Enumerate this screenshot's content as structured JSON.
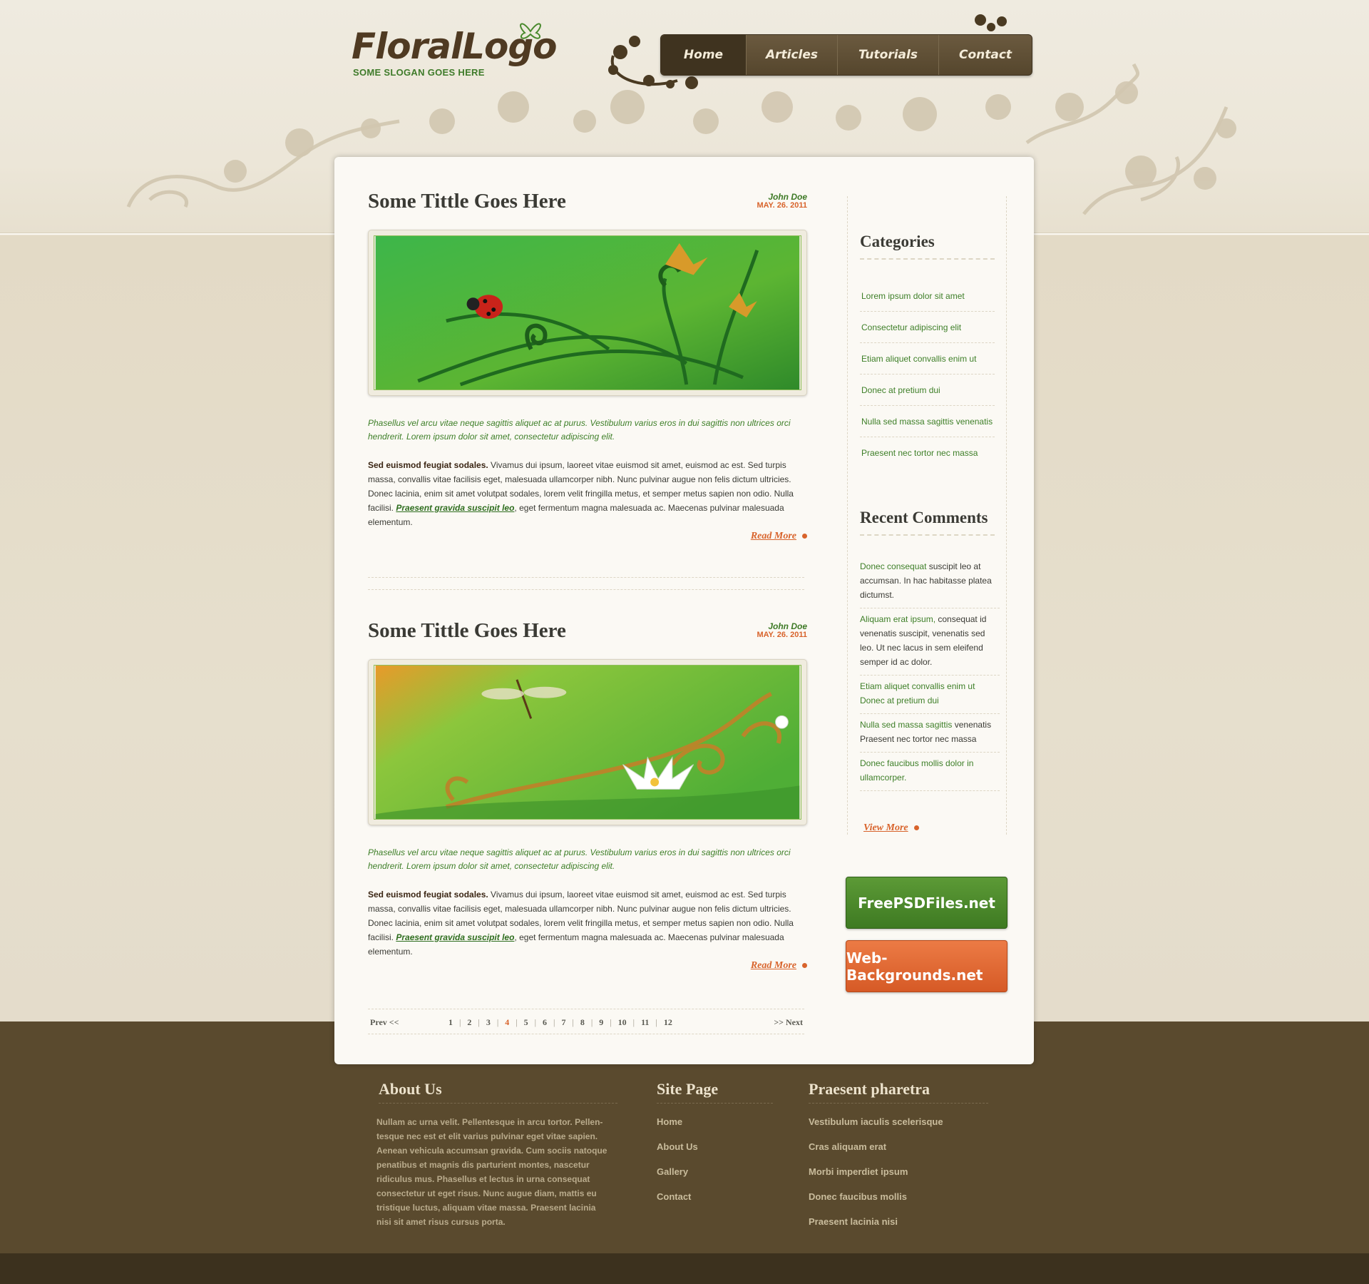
{
  "brand": {
    "logo": "FloralLogo",
    "slogan": "SOME SLOGAN GOES HERE"
  },
  "nav": {
    "items": [
      {
        "label": "Home",
        "active": true
      },
      {
        "label": "Articles",
        "active": false
      },
      {
        "label": "Tutorials",
        "active": false
      },
      {
        "label": "Contact",
        "active": false
      }
    ]
  },
  "posts": [
    {
      "title": "Some Tittle Goes Here",
      "author": "John Doe",
      "date": "MAY. 26. 2011",
      "image_icon": "ladybug-grass-illustration",
      "intro": "Phasellus vel arcu vitae neque sagittis aliquet ac at purus. Vestibulum varius eros in dui sagittis non ultrices orci hendrerit. Lorem ipsum dolor sit amet, consectetur adipiscing elit.",
      "body_lead": "Sed euismod feugiat sodales.",
      "body_text": " Vivamus dui ipsum, laoreet vitae euismod sit amet, euismod ac est. Sed turpis massa, convallis vitae facilisis eget, malesuada ullamcorper nibh. Nunc pulvinar augue non felis dictum ultricies. Donec lacinia, enim sit amet volutpat sodales, lorem velit fringilla metus, et semper metus sapien non odio. Nulla facilisi. ",
      "body_link": "Praesent gravida suscipit leo",
      "body_tail": ", eget fermentum magna malesuada ac. Maecenas pulvinar malesuada elementum.",
      "read_more": "Read More"
    },
    {
      "title": "Some Tittle Goes Here",
      "author": "John Doe",
      "date": "MAY. 26. 2011",
      "image_icon": "dragonfly-lotus-illustration",
      "intro": "Phasellus vel arcu vitae neque sagittis aliquet ac at purus. Vestibulum varius eros in dui sagittis non ultrices orci hendrerit. Lorem ipsum dolor sit amet, consectetur adipiscing elit.",
      "body_lead": "Sed euismod feugiat sodales.",
      "body_text": " Vivamus dui ipsum, laoreet vitae euismod sit amet, euismod ac est. Sed turpis massa, convallis vitae facilisis eget, malesuada ullamcorper nibh. Nunc pulvinar augue non felis dictum ultricies. Donec lacinia, enim sit amet volutpat sodales, lorem velit fringilla metus, et semper metus sapien non odio. Nulla facilisi. ",
      "body_link": "Praesent gravida suscipit leo",
      "body_tail": ", eget fermentum magna malesuada ac. Maecenas pulvinar malesuada elementum.",
      "read_more": "Read More"
    }
  ],
  "pagination": {
    "prev": "Prev <<",
    "next": ">> Next",
    "pages": [
      "1",
      "2",
      "3",
      "4",
      "5",
      "6",
      "7",
      "8",
      "9",
      "10",
      "11",
      "12"
    ],
    "current": "4"
  },
  "sidebar": {
    "categories_title": "Categories",
    "categories": [
      "Lorem ipsum dolor sit amet",
      "Consectetur adipiscing elit",
      "Etiam aliquet convallis enim ut",
      "Donec at pretium dui",
      "Nulla sed massa sagittis venenatis",
      "Praesent nec tortor nec massa"
    ],
    "comments_title": "Recent Comments",
    "comments": [
      {
        "highlight": "Donec consequat",
        "text": " suscipit leo at accumsan. In hac habitasse platea dictumst."
      },
      {
        "highlight": "Aliquam erat ipsum,",
        "text": " consequat id venenatis suscipit, venenatis sed leo. Ut nec lacus in sem eleifend semper id ac dolor."
      },
      {
        "highlight": "Etiam aliquet convallis enim ut Donec at pretium dui",
        "text": ""
      },
      {
        "highlight": "Nulla sed massa sagittis",
        "text": " venenatis Praesent nec tortor nec massa"
      },
      {
        "highlight": "Donec faucibus mollis dolor in ullamcorper.",
        "text": ""
      }
    ],
    "view_more": "View More"
  },
  "banners": {
    "green": "FreePSDFiles.net",
    "orange": "Web-Backgrounds.net"
  },
  "footer": {
    "about_title": "About Us",
    "about_text": "Nullam ac urna velit. Pellentesque in arcu tortor. Pellen-tesque nec est et elit varius pulvinar eget vitae sapien. Aenean vehicula accumsan gravida. Cum sociis natoque penatibus et magnis dis parturient montes, nascetur ridiculus mus. Phasellus et lectus in urna consequat consectetur ut eget risus. Nunc augue diam, mattis eu tristique luctus, aliquam vitae massa. Praesent lacinia nisi sit amet risus cursus porta.",
    "site_title": "Site Page",
    "site_links": [
      "Home",
      "About Us",
      "Gallery",
      "Contact"
    ],
    "extra_title": "Praesent pharetra",
    "extra_links": [
      "Vestibulum iaculis scelerisque",
      "Cras aliquam erat",
      "Morbi imperdiet ipsum",
      "Donec faucibus mollis",
      "Praesent lacinia nisi"
    ]
  },
  "colors": {
    "accent_orange": "#d8632b",
    "accent_green": "#3e7f28",
    "brown": "#5a4a2e"
  }
}
